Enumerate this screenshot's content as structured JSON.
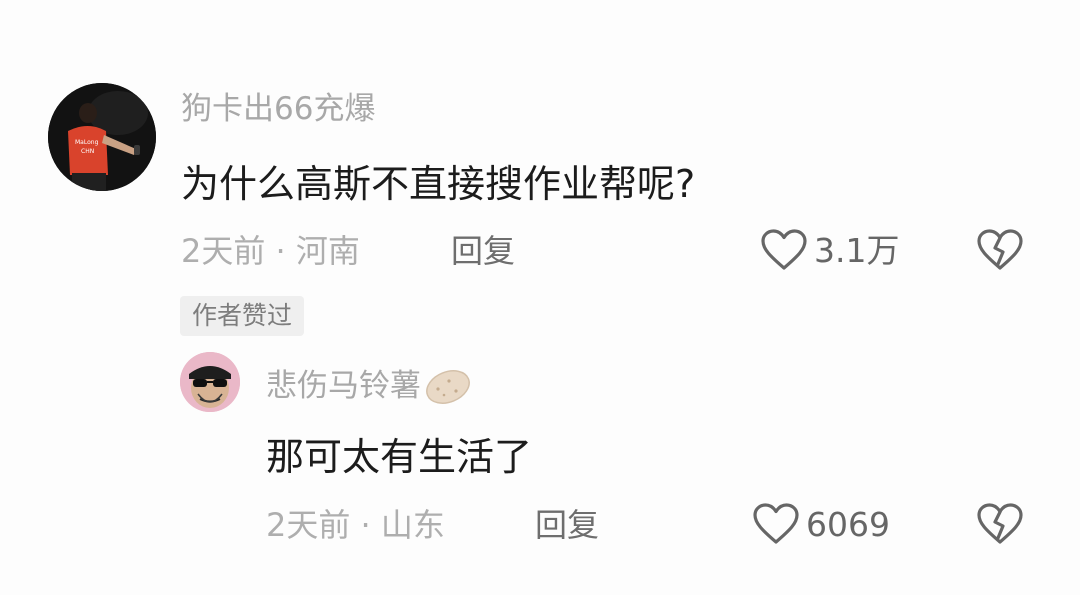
{
  "colors": {
    "background": "#fdfdfd",
    "username": "#a8a8a8",
    "meta": "#aeaeae",
    "reply_button": "#6e6e6e",
    "tag_bg": "#efefef"
  },
  "comment": {
    "avatar_icon": "avatar-player-red-shirt",
    "username": "狗卡出66充爆",
    "text": "为什么高斯不直接搜作业帮呢?",
    "time_location": "2天前 · 河南",
    "reply_label": "回复",
    "like_icon": "heart-outline-icon",
    "like_count": "3.1万",
    "dislike_icon": "broken-heart-icon",
    "author_tag": "作者赞过"
  },
  "reply": {
    "avatar_icon": "avatar-cartoon-sunglasses",
    "username": "悲伤马铃薯",
    "username_emoji": "potato-emoji",
    "text": "那可太有生活了",
    "time_location": "2天前 · 山东",
    "reply_label": "回复",
    "like_icon": "heart-outline-icon",
    "like_count": "6069",
    "dislike_icon": "broken-heart-icon"
  }
}
